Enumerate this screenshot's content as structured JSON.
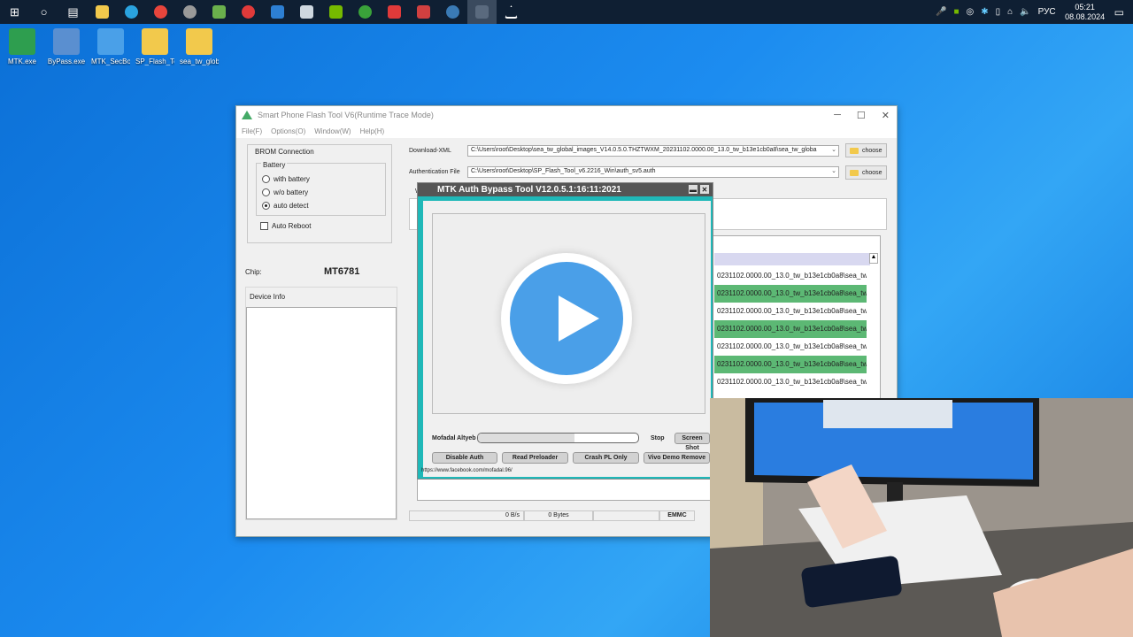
{
  "taskbar": {
    "apps": [
      {
        "icon": "windows-start-icon",
        "color": "#ffffff"
      },
      {
        "icon": "search-icon",
        "color": "#ffffff"
      },
      {
        "icon": "task-view-icon",
        "color": "#ffffff"
      },
      {
        "icon": "file-explorer-icon",
        "color": "#f2c94c"
      },
      {
        "icon": "telegram-icon",
        "color": "#2aa3e0"
      },
      {
        "icon": "chrome-icon",
        "color": "#e8453c"
      },
      {
        "icon": "settings-app-icon",
        "color": "#999999"
      },
      {
        "icon": "notepad-icon",
        "color": "#6ab04c"
      },
      {
        "icon": "opera-icon",
        "color": "#e03a3a"
      },
      {
        "icon": "lt-app-icon",
        "color": "#2d7fd3"
      },
      {
        "icon": "steam-icon",
        "color": "#cfd8e0"
      },
      {
        "icon": "nvidia-icon",
        "color": "#76b900"
      },
      {
        "icon": "xbox-icon",
        "color": "#3aa23a"
      },
      {
        "icon": "media-app-icon",
        "color": "#e03a3a"
      },
      {
        "icon": "record-app-icon",
        "color": "#d04040"
      },
      {
        "icon": "tool-app-icon",
        "color": "#3a7ab5"
      },
      {
        "icon": "active-app-icon",
        "color": "#5a6a7e"
      },
      {
        "icon": "flash-tool-taskbar-icon",
        "color": "#ffffff"
      }
    ],
    "tray": {
      "language": "РУС",
      "time": "05:21",
      "date": "08.08.2024"
    }
  },
  "desktop": {
    "icons": [
      {
        "label": "MTK.exe",
        "color": "#2e9e4f"
      },
      {
        "label": "ByPass.exe",
        "color": "#5a8fd0"
      },
      {
        "label": "MTK_SecBo...",
        "color": "#4aa0e8"
      },
      {
        "label": "SP_Flash_To...",
        "color": "#f2c94c"
      },
      {
        "label": "sea_tw_glob...",
        "color": "#f2c94c"
      }
    ]
  },
  "spft": {
    "title": "Smart Phone Flash Tool V6(Runtime Trace Mode)",
    "menu": [
      "File(F)",
      "Options(O)",
      "Window(W)",
      "Help(H)"
    ],
    "brom_connection": "BROM Connection",
    "battery": "Battery",
    "with_battery": "with battery",
    "wo_battery": "w/o battery",
    "auto_detect": "auto detect",
    "auto_reboot": "Auto Reboot",
    "chip_label": "Chip:",
    "chip_value": "MT6781",
    "device_info": "Device Info",
    "download_xml_label": "Download-XML",
    "download_xml_path": "C:\\Users\\root\\Desktop\\sea_tw_global_images_V14.0.5.0.THZTWXM_20231102.0000.00_13.0_tw_b13e1cb0a8\\sea_tw_globa",
    "auth_file_label": "Authentication File",
    "auth_file_path": "C:\\Users\\root\\Desktop\\SP_Flash_Tool_v6.2216_Win\\auth_sv5.auth",
    "choose": "choose",
    "partial_label": "W",
    "rows": [
      "0231102.0000.00_13.0_tw_b13e1cb0a8\\sea_tw_g...",
      "0231102.0000.00_13.0_tw_b13e1cb0a8\\sea_tw_g...",
      "0231102.0000.00_13.0_tw_b13e1cb0a8\\sea_tw_g...",
      "0231102.0000.00_13.0_tw_b13e1cb0a8\\sea_tw_g...",
      "0231102.0000.00_13.0_tw_b13e1cb0a8\\sea_tw_g...",
      "0231102.0000.00_13.0_tw_b13e1cb0a8\\sea_tw_g...",
      "0231102.0000.00_13.0_tw_b13e1cb0a8\\sea_tw_g..."
    ],
    "status": {
      "speed": "0 B/s",
      "bytes": "0 Bytes",
      "storage": "EMMC"
    }
  },
  "mtk_tool": {
    "title": "MTK Auth Bypass Tool V12.0.5.1:16:11:2021",
    "author": "Mofadal Altyeb",
    "progress": 0.6,
    "stop": "Stop",
    "screenshot": "Screen Shot",
    "buttons": [
      "Disable Auth",
      "Read Preloader",
      "Crash PL Only",
      "Vivo Demo Remove"
    ],
    "link": "https://www.facebook.com/mofadal.96/"
  },
  "overlay": {
    "play_icon": "play-icon"
  }
}
